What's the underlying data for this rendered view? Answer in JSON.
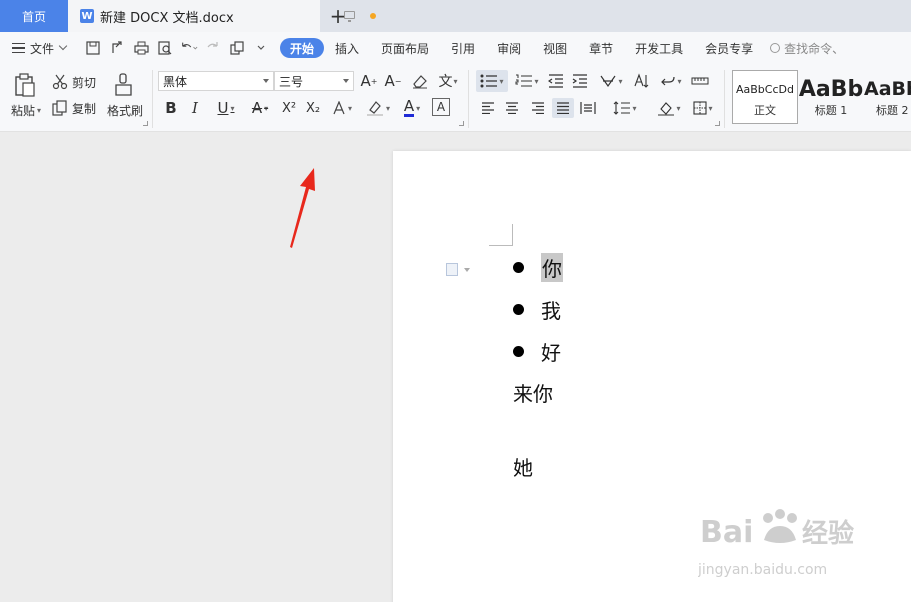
{
  "tabs": {
    "home": "首页",
    "doc_icon": "W",
    "doc_title": "新建 DOCX 文档.docx",
    "add": "+"
  },
  "menu": {
    "file": "文件",
    "tabs": [
      "开始",
      "插入",
      "页面布局",
      "引用",
      "审阅",
      "视图",
      "章节",
      "开发工具",
      "会员专享"
    ],
    "search_placeholder": "查找命令、"
  },
  "ribbon": {
    "paste": "粘贴",
    "cut": "剪切",
    "copy": "复制",
    "format_painter": "格式刷",
    "font_name": "黑体",
    "font_size": "三号",
    "bold": "B",
    "italic": "I",
    "underline": "U",
    "strike": "A",
    "superscript": "X²",
    "subscript": "X₂",
    "font_color": "A",
    "char_border": "A",
    "phonetic": "文",
    "styles": [
      {
        "preview": "AaBbCcDd",
        "name": "正文"
      },
      {
        "preview": "AaBb",
        "name": "标题 1"
      },
      {
        "preview": "AaBb",
        "name": "标题 2"
      }
    ]
  },
  "document": {
    "bullets": [
      "你",
      "我",
      "好"
    ],
    "lines": [
      "来你",
      "她"
    ]
  },
  "colors": {
    "accent": "#4b83e8",
    "arrow": "#e8281c",
    "modified_dot": "#f5a623"
  }
}
